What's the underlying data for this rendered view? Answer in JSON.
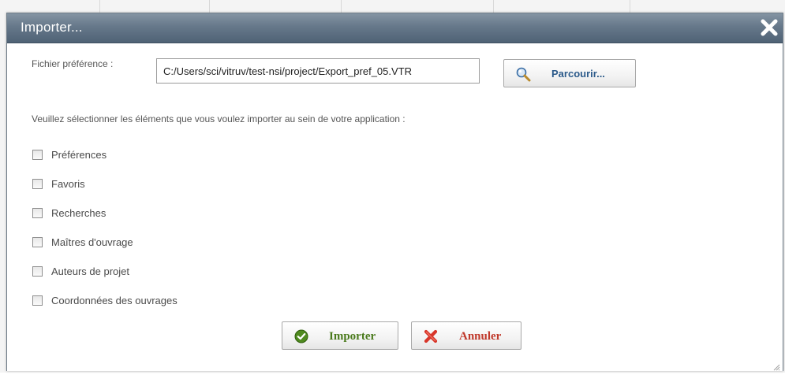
{
  "dialog": {
    "title": "Importer..."
  },
  "file": {
    "label": "Fichier préférence :",
    "value": "C:/Users/sci/vitruv/test-nsi/project/Export_pref_05.VTR",
    "browse_label": "Parcourir..."
  },
  "instruction": "Veuillez sélectionner les éléments que vous voulez importer au sein de votre application :",
  "options": [
    {
      "label": "Préférences",
      "checked": false
    },
    {
      "label": "Favoris",
      "checked": false
    },
    {
      "label": "Recherches",
      "checked": false
    },
    {
      "label": "Maîtres d'ouvrage",
      "checked": false
    },
    {
      "label": "Auteurs de projet",
      "checked": false
    },
    {
      "label": "Coordonnées des ouvrages",
      "checked": false
    }
  ],
  "actions": {
    "import_label": "Importer",
    "cancel_label": "Annuler"
  },
  "icons": {
    "close": "close-icon",
    "browse": "magnifier-icon",
    "import": "check-circle-icon",
    "cancel": "cross-icon"
  },
  "colors": {
    "titlebar": "#66788a",
    "import_text": "#4a7a1c",
    "cancel_text": "#c0392b",
    "browse_text": "#2b5a8a"
  }
}
